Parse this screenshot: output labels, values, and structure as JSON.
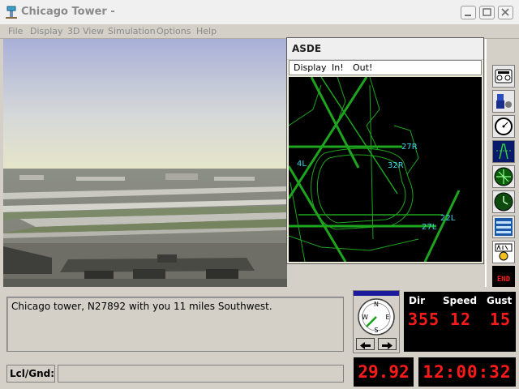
{
  "window": {
    "title": "Chicago Tower -"
  },
  "menu": [
    {
      "label": "File"
    },
    {
      "label": "Display"
    },
    {
      "label": "3D View"
    },
    {
      "label": "Simulation"
    },
    {
      "label": "Options"
    },
    {
      "label": "Help"
    }
  ],
  "asde": {
    "title": "ASDE",
    "menu": [
      {
        "label": "Display"
      },
      {
        "label": "In!"
      },
      {
        "label": "Out!"
      }
    ],
    "runway_labels": [
      "27R",
      "4L",
      "32R",
      "22L",
      "27L"
    ]
  },
  "toolbar": {
    "icons": [
      "radio-panel-icon",
      "controller-icon",
      "gauge-icon",
      "radar-scope-icon",
      "green-radar-icon",
      "clock-icon",
      "strip-bay-icon",
      "abc-atis-icon",
      "end-icon"
    ],
    "end_label": "END"
  },
  "message": {
    "text": "Chicago tower, N27892 with you 11 miles Southwest."
  },
  "input": {
    "label": "Lcl/Gnd:",
    "value": ""
  },
  "compass": {
    "letters": {
      "n": "N",
      "e": "E",
      "s": "S",
      "w": "W"
    },
    "heading_deg": 225
  },
  "wind": {
    "dir_label": "Dir",
    "speed_label": "Speed",
    "gust_label": "Gust",
    "dir": "355",
    "speed": "12",
    "gust": "15"
  },
  "altimeter": "29.92",
  "clock": "12:00:32",
  "colors": {
    "led": "#ff1a1a",
    "radar_line": "#1ea51e",
    "runway_label": "#3fd7e6"
  }
}
